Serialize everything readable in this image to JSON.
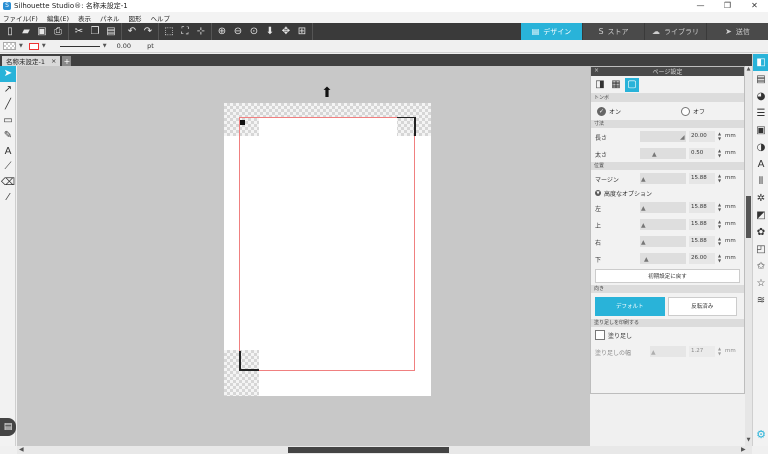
{
  "window": {
    "title": "Silhouette Studio®: 名称未設定-1",
    "controls": [
      "—",
      "❐",
      "✕"
    ]
  },
  "menu": [
    "ファイル(F)",
    "編集(E)",
    "表示",
    "パネル",
    "図形",
    "ヘルプ"
  ],
  "nav_tabs": [
    {
      "label": "デザイン",
      "icon": "▤",
      "active": true
    },
    {
      "label": "ストア",
      "icon": "S",
      "active": false
    },
    {
      "label": "ライブラリ",
      "icon": "☁",
      "active": false
    },
    {
      "label": "送信",
      "icon": "➤",
      "active": false
    }
  ],
  "props": {
    "line_width": "0.00",
    "unit": "pt"
  },
  "doc_tab": {
    "name": "名称未設定-1",
    "close": "×",
    "add": "+"
  },
  "panel": {
    "title": "ページ設定",
    "close": "×",
    "registration_section": "トンボ",
    "on_label": "オン",
    "off_label": "オフ",
    "size_section": "寸法",
    "length_label": "長さ",
    "length_value": "20.00",
    "thickness_label": "太さ",
    "thickness_value": "0.50",
    "position_section": "位置",
    "margin_label": "マージン",
    "margin_value": "15.88",
    "advanced_label": "高度なオプション",
    "left_label": "左",
    "left_value": "15.88",
    "top_label": "上",
    "top_value": "15.88",
    "right_label": "右",
    "right_value": "15.88",
    "bottom_label": "下",
    "bottom_value": "26.00",
    "unit": "mm",
    "reset_button": "初期設定に戻す",
    "orientation_section": "向き",
    "default_label": "デフォルト",
    "reversed_label": "反転済み",
    "bleed_section": "塗り足しを印刷する",
    "bleed_label": "塗り足し",
    "bleed_width_label": "塗り足しの幅",
    "bleed_width_value": "1.27"
  },
  "colors": {
    "accent": "#29b3d9",
    "toolbar": "#3a3a3a",
    "canvas": "#c8c8c8",
    "page_outline": "#f08080"
  }
}
